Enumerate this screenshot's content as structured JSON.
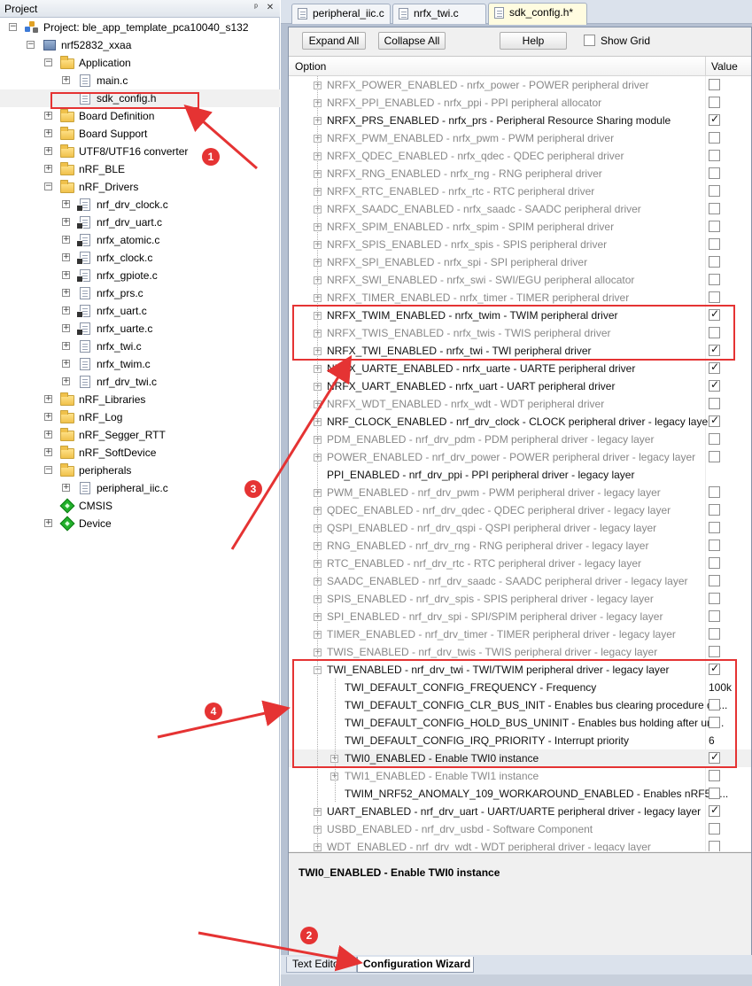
{
  "project_pane": {
    "title": "Project",
    "pin_glyph": "ᵖ",
    "close_glyph": "✕",
    "tree": [
      {
        "label": "Project: ble_app_template_pca10040_s132",
        "icon": "project-icon",
        "expander": "minus"
      },
      {
        "label": "nrf52832_xxaa",
        "icon": "target-icon",
        "expander": "minus"
      },
      {
        "label": "Application",
        "icon": "folder-icon",
        "expander": "minus"
      },
      {
        "label": "main.c",
        "icon": "file-icon",
        "expander": "plus"
      },
      {
        "label": "sdk_config.h",
        "icon": "file-icon",
        "expander": ""
      },
      {
        "label": "Board Definition",
        "icon": "folder-icon",
        "expander": "plus"
      },
      {
        "label": "Board Support",
        "icon": "folder-icon",
        "expander": "plus"
      },
      {
        "label": "UTF8/UTF16 converter",
        "icon": "folder-icon",
        "expander": "plus"
      },
      {
        "label": "nRF_BLE",
        "icon": "folder-icon",
        "expander": "plus"
      },
      {
        "label": "nRF_Drivers",
        "icon": "folder-icon",
        "expander": "minus"
      },
      {
        "label": "nrf_drv_clock.c",
        "icon": "locked-file-icon",
        "expander": "plus"
      },
      {
        "label": "nrf_drv_uart.c",
        "icon": "locked-file-icon",
        "expander": "plus"
      },
      {
        "label": "nrfx_atomic.c",
        "icon": "locked-file-icon",
        "expander": "plus"
      },
      {
        "label": "nrfx_clock.c",
        "icon": "locked-file-icon",
        "expander": "plus"
      },
      {
        "label": "nrfx_gpiote.c",
        "icon": "locked-file-icon",
        "expander": "plus"
      },
      {
        "label": "nrfx_prs.c",
        "icon": "file-icon",
        "expander": "plus"
      },
      {
        "label": "nrfx_uart.c",
        "icon": "locked-file-icon",
        "expander": "plus"
      },
      {
        "label": "nrfx_uarte.c",
        "icon": "locked-file-icon",
        "expander": "plus"
      },
      {
        "label": "nrfx_twi.c",
        "icon": "file-icon",
        "expander": "plus"
      },
      {
        "label": "nrfx_twim.c",
        "icon": "file-icon",
        "expander": "plus"
      },
      {
        "label": "nrf_drv_twi.c",
        "icon": "file-icon",
        "expander": "plus"
      },
      {
        "label": "nRF_Libraries",
        "icon": "folder-icon",
        "expander": "plus"
      },
      {
        "label": "nRF_Log",
        "icon": "folder-icon",
        "expander": "plus"
      },
      {
        "label": "nRF_Segger_RTT",
        "icon": "folder-icon",
        "expander": "plus"
      },
      {
        "label": "nRF_SoftDevice",
        "icon": "folder-icon",
        "expander": "plus"
      },
      {
        "label": "peripherals",
        "icon": "folder-icon",
        "expander": "minus"
      },
      {
        "label": "peripheral_iic.c",
        "icon": "file-icon",
        "expander": "plus"
      },
      {
        "label": "CMSIS",
        "icon": "component-icon",
        "expander": ""
      },
      {
        "label": "Device",
        "icon": "component-icon",
        "expander": "plus"
      }
    ]
  },
  "editor_tabs": [
    {
      "label": "peripheral_iic.c",
      "active": false
    },
    {
      "label": "nrfx_twi.c",
      "active": false
    },
    {
      "label": "sdk_config.h*",
      "active": true
    }
  ],
  "toolbar": {
    "expand_all": "Expand All",
    "collapse_all": "Collapse All",
    "help": "Help",
    "show_grid": "Show Grid"
  },
  "grid": {
    "col_option": "Option",
    "col_value": "Value",
    "rows": [
      {
        "label": "NRFX_POWER_ENABLED - nrfx_power - POWER peripheral driver",
        "enabled": false,
        "checked": false,
        "indent": 1,
        "expander": "plus"
      },
      {
        "label": "NRFX_PPI_ENABLED - nrfx_ppi - PPI peripheral allocator",
        "enabled": false,
        "checked": false,
        "indent": 1,
        "expander": "plus"
      },
      {
        "label": "NRFX_PRS_ENABLED - nrfx_prs - Peripheral Resource Sharing module",
        "enabled": true,
        "checked": true,
        "indent": 1,
        "expander": "plus"
      },
      {
        "label": "NRFX_PWM_ENABLED - nrfx_pwm - PWM peripheral driver",
        "enabled": false,
        "checked": false,
        "indent": 1,
        "expander": "plus"
      },
      {
        "label": "NRFX_QDEC_ENABLED - nrfx_qdec - QDEC peripheral driver",
        "enabled": false,
        "checked": false,
        "indent": 1,
        "expander": "plus"
      },
      {
        "label": "NRFX_RNG_ENABLED - nrfx_rng - RNG peripheral driver",
        "enabled": false,
        "checked": false,
        "indent": 1,
        "expander": "plus"
      },
      {
        "label": "NRFX_RTC_ENABLED - nrfx_rtc - RTC peripheral driver",
        "enabled": false,
        "checked": false,
        "indent": 1,
        "expander": "plus"
      },
      {
        "label": "NRFX_SAADC_ENABLED - nrfx_saadc - SAADC peripheral driver",
        "enabled": false,
        "checked": false,
        "indent": 1,
        "expander": "plus"
      },
      {
        "label": "NRFX_SPIM_ENABLED - nrfx_spim - SPIM peripheral driver",
        "enabled": false,
        "checked": false,
        "indent": 1,
        "expander": "plus"
      },
      {
        "label": "NRFX_SPIS_ENABLED - nrfx_spis - SPIS peripheral driver",
        "enabled": false,
        "checked": false,
        "indent": 1,
        "expander": "plus"
      },
      {
        "label": "NRFX_SPI_ENABLED - nrfx_spi - SPI peripheral driver",
        "enabled": false,
        "checked": false,
        "indent": 1,
        "expander": "plus"
      },
      {
        "label": "NRFX_SWI_ENABLED - nrfx_swi - SWI/EGU peripheral allocator",
        "enabled": false,
        "checked": false,
        "indent": 1,
        "expander": "plus"
      },
      {
        "label": "NRFX_TIMER_ENABLED - nrfx_timer - TIMER peripheral driver",
        "enabled": false,
        "checked": false,
        "indent": 1,
        "expander": "plus"
      },
      {
        "label": "NRFX_TWIM_ENABLED - nrfx_twim - TWIM peripheral driver",
        "enabled": true,
        "checked": true,
        "indent": 1,
        "expander": "plus"
      },
      {
        "label": "NRFX_TWIS_ENABLED - nrfx_twis - TWIS peripheral driver",
        "enabled": false,
        "checked": false,
        "indent": 1,
        "expander": "plus"
      },
      {
        "label": "NRFX_TWI_ENABLED - nrfx_twi - TWI peripheral driver",
        "enabled": true,
        "checked": true,
        "indent": 1,
        "expander": "plus"
      },
      {
        "label": "NRFX_UARTE_ENABLED - nrfx_uarte - UARTE peripheral driver",
        "enabled": true,
        "checked": true,
        "indent": 1,
        "expander": "plus"
      },
      {
        "label": "NRFX_UART_ENABLED - nrfx_uart - UART peripheral driver",
        "enabled": true,
        "checked": true,
        "indent": 1,
        "expander": "plus"
      },
      {
        "label": "NRFX_WDT_ENABLED - nrfx_wdt - WDT peripheral driver",
        "enabled": false,
        "checked": false,
        "indent": 1,
        "expander": "plus"
      },
      {
        "label": "NRF_CLOCK_ENABLED - nrf_drv_clock - CLOCK peripheral driver - legacy layer",
        "enabled": true,
        "checked": true,
        "indent": 1,
        "expander": "plus"
      },
      {
        "label": "PDM_ENABLED - nrf_drv_pdm - PDM peripheral driver - legacy layer",
        "enabled": false,
        "checked": false,
        "indent": 1,
        "expander": "plus"
      },
      {
        "label": "POWER_ENABLED - nrf_drv_power - POWER peripheral driver - legacy layer",
        "enabled": false,
        "checked": false,
        "indent": 1,
        "expander": "plus"
      },
      {
        "label": "PPI_ENABLED  - nrf_drv_ppi - PPI peripheral driver - legacy layer",
        "enabled": true,
        "checked": false,
        "indent": 1,
        "expander": "",
        "no_box": true
      },
      {
        "label": "PWM_ENABLED - nrf_drv_pwm - PWM peripheral driver - legacy layer",
        "enabled": false,
        "checked": false,
        "indent": 1,
        "expander": "plus"
      },
      {
        "label": "QDEC_ENABLED - nrf_drv_qdec - QDEC peripheral driver - legacy layer",
        "enabled": false,
        "checked": false,
        "indent": 1,
        "expander": "plus"
      },
      {
        "label": "QSPI_ENABLED - nrf_drv_qspi - QSPI peripheral driver - legacy layer",
        "enabled": false,
        "checked": false,
        "indent": 1,
        "expander": "plus"
      },
      {
        "label": "RNG_ENABLED - nrf_drv_rng - RNG peripheral driver - legacy layer",
        "enabled": false,
        "checked": false,
        "indent": 1,
        "expander": "plus"
      },
      {
        "label": "RTC_ENABLED - nrf_drv_rtc - RTC peripheral driver - legacy layer",
        "enabled": false,
        "checked": false,
        "indent": 1,
        "expander": "plus"
      },
      {
        "label": "SAADC_ENABLED - nrf_drv_saadc - SAADC peripheral driver - legacy layer",
        "enabled": false,
        "checked": false,
        "indent": 1,
        "expander": "plus"
      },
      {
        "label": "SPIS_ENABLED - nrf_drv_spis - SPIS peripheral driver - legacy layer",
        "enabled": false,
        "checked": false,
        "indent": 1,
        "expander": "plus"
      },
      {
        "label": "SPI_ENABLED - nrf_drv_spi - SPI/SPIM peripheral driver - legacy layer",
        "enabled": false,
        "checked": false,
        "indent": 1,
        "expander": "plus"
      },
      {
        "label": "TIMER_ENABLED - nrf_drv_timer - TIMER peripheral driver - legacy layer",
        "enabled": false,
        "checked": false,
        "indent": 1,
        "expander": "plus"
      },
      {
        "label": "TWIS_ENABLED - nrf_drv_twis - TWIS peripheral driver - legacy layer",
        "enabled": false,
        "checked": false,
        "indent": 1,
        "expander": "plus"
      },
      {
        "label": "TWI_ENABLED - nrf_drv_twi - TWI/TWIM peripheral driver - legacy layer",
        "enabled": true,
        "checked": true,
        "indent": 1,
        "expander": "minus"
      },
      {
        "label": "TWI_DEFAULT_CONFIG_FREQUENCY  - Frequency",
        "enabled": true,
        "value": "100k",
        "indent": 2,
        "expander": ""
      },
      {
        "label": "TWI_DEFAULT_CONFIG_CLR_BUS_INIT  - Enables bus clearing procedure du...",
        "enabled": true,
        "checked": false,
        "indent": 2,
        "expander": ""
      },
      {
        "label": "TWI_DEFAULT_CONFIG_HOLD_BUS_UNINIT  - Enables bus holding after uni...",
        "enabled": true,
        "checked": false,
        "indent": 2,
        "expander": ""
      },
      {
        "label": "TWI_DEFAULT_CONFIG_IRQ_PRIORITY  - Interrupt priority",
        "enabled": true,
        "value": "6",
        "indent": 2,
        "expander": ""
      },
      {
        "label": "TWI0_ENABLED - Enable TWI0 instance",
        "enabled": true,
        "checked": true,
        "indent": 2,
        "expander": "plus",
        "highlight": true
      },
      {
        "label": "TWI1_ENABLED - Enable TWI1 instance",
        "enabled": false,
        "checked": false,
        "indent": 2,
        "expander": "plus"
      },
      {
        "label": "TWIM_NRF52_ANOMALY_109_WORKAROUND_ENABLED  - Enables nRF52 ...",
        "enabled": true,
        "checked": false,
        "indent": 2,
        "expander": ""
      },
      {
        "label": "UART_ENABLED - nrf_drv_uart - UART/UARTE peripheral driver - legacy layer",
        "enabled": true,
        "checked": true,
        "indent": 1,
        "expander": "plus"
      },
      {
        "label": "USBD_ENABLED - nrf_drv_usbd - Software Component",
        "enabled": false,
        "checked": false,
        "indent": 1,
        "expander": "plus"
      },
      {
        "label": "WDT_ENABLED - nrf_drv_wdt - WDT peripheral driver - legacy layer",
        "enabled": false,
        "checked": false,
        "indent": 1,
        "expander": "plus"
      }
    ]
  },
  "description": {
    "title": "TWI0_ENABLED - Enable TWI0 instance"
  },
  "bottom_tabs": {
    "text_editor": "Text Editor",
    "config_wizard": "Configuration Wizard"
  },
  "annotations": {
    "markers": [
      "1",
      "2",
      "3",
      "4"
    ],
    "color": "#e53333"
  },
  "colors": {
    "disabled_text": "#888888",
    "enabled_text": "#111111",
    "active_tab": "#fffce0"
  }
}
